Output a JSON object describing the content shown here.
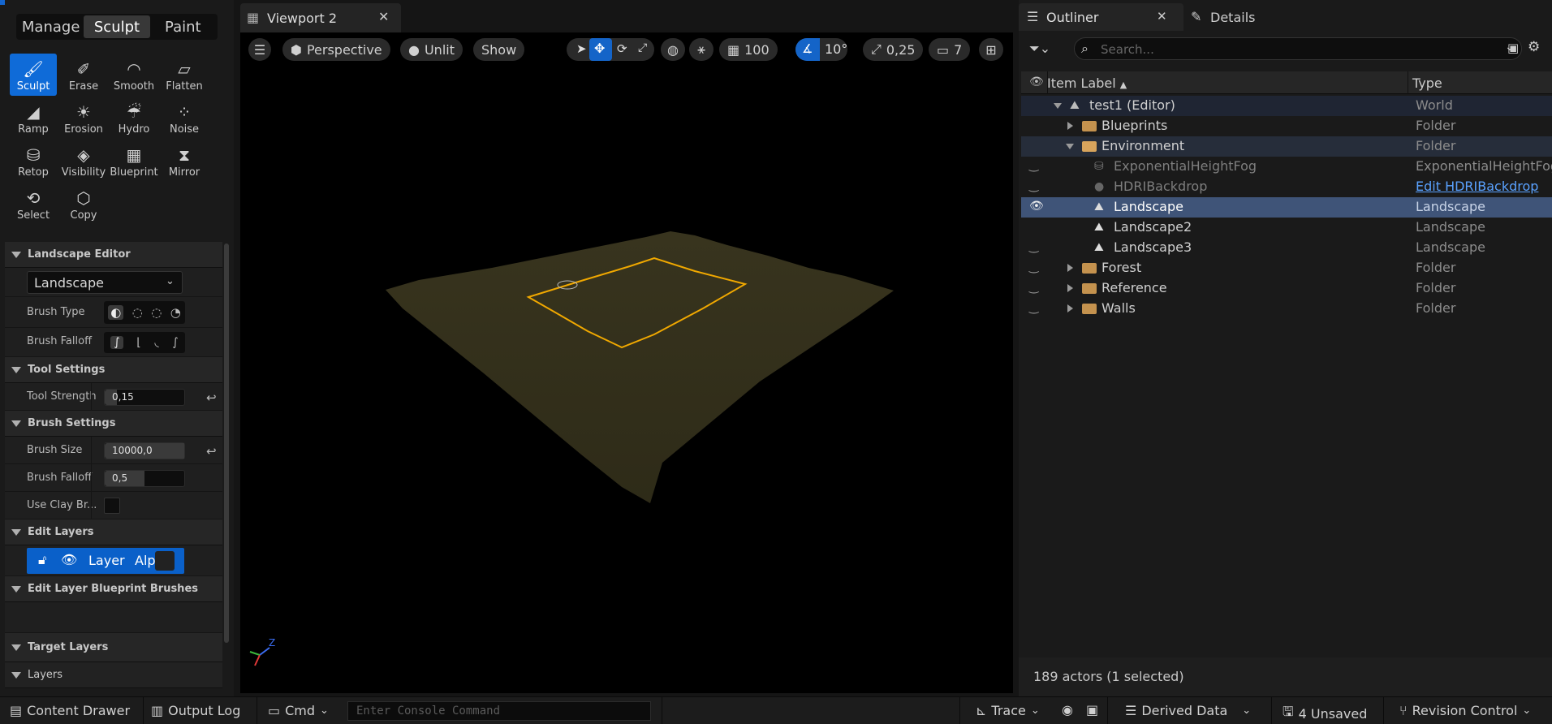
{
  "modes": [
    {
      "label": "Manage",
      "active": false
    },
    {
      "label": "Sculpt",
      "active": true
    },
    {
      "label": "Paint",
      "active": false
    }
  ],
  "tools": [
    {
      "label": "Sculpt",
      "icon": "brush-icon",
      "glyph": "🖌",
      "active": true
    },
    {
      "label": "Erase",
      "icon": "eraser-icon",
      "glyph": "✐",
      "active": false
    },
    {
      "label": "Smooth",
      "icon": "smooth-icon",
      "glyph": "◠",
      "active": false
    },
    {
      "label": "Flatten",
      "icon": "flatten-icon",
      "glyph": "⏥",
      "active": false
    },
    {
      "label": "Ramp",
      "icon": "ramp-icon",
      "glyph": "◢",
      "active": false
    },
    {
      "label": "Erosion",
      "icon": "erosion-icon",
      "glyph": "☀",
      "active": false
    },
    {
      "label": "Hydro",
      "icon": "hydro-icon",
      "glyph": "☔",
      "active": false
    },
    {
      "label": "Noise",
      "icon": "noise-icon",
      "glyph": "⁘",
      "active": false
    },
    {
      "label": "Retop",
      "icon": "retopologize-icon",
      "glyph": "⛁",
      "active": false
    },
    {
      "label": "Visibility",
      "icon": "visibility-icon",
      "glyph": "◈",
      "active": false
    },
    {
      "label": "Blueprint",
      "icon": "blueprint-icon",
      "glyph": "▦",
      "active": false
    },
    {
      "label": "Mirror",
      "icon": "mirror-icon",
      "glyph": "⧗",
      "active": false
    },
    {
      "label": "Select",
      "icon": "select-icon",
      "glyph": "⟲",
      "active": false
    },
    {
      "label": "Copy",
      "icon": "copy-icon",
      "glyph": "⬡",
      "active": false
    }
  ],
  "landscape_editor": {
    "title": "Landscape Editor",
    "selected_landscape": "Landscape",
    "brush_type_label": "Brush Type",
    "brush_falloff_label": "Brush Falloff"
  },
  "tool_settings": {
    "title": "Tool Settings",
    "tool_strength_label": "Tool Strength",
    "tool_strength_value": "0,15",
    "tool_strength_fraction": 0.15
  },
  "brush_settings": {
    "title": "Brush Settings",
    "brush_size_label": "Brush Size",
    "brush_size_value": "10000,0",
    "brush_size_fraction": 1.0,
    "brush_falloff_label": "Brush Falloff",
    "brush_falloff_value": "0,5",
    "brush_falloff_fraction": 0.5,
    "use_clay_label": "Use Clay Br..."
  },
  "edit_layers": {
    "title": "Edit Layers",
    "layer_name": "Layer",
    "alpha_label": "Alp"
  },
  "sections": {
    "blueprint_brushes": "Edit Layer Blueprint Brushes",
    "target_layers": "Target Layers",
    "layers": "Layers"
  },
  "viewport": {
    "tab_title": "Viewport 2",
    "perspective": "Perspective",
    "lit_mode": "Unlit",
    "show": "Show",
    "grid_snap": "100",
    "rotation_snap": "10°",
    "scale_snap": "0,25",
    "camera_speed": "7",
    "axis_z": "Z"
  },
  "outliner": {
    "tab_title": "Outliner",
    "details_tab": "Details",
    "search_placeholder": "Search...",
    "col_label": "Item Label",
    "col_type": "Type",
    "rows": [
      {
        "label": "test1 (Editor)",
        "type": "World",
        "indent": 0,
        "kind": "world",
        "expander": "open",
        "eye": false,
        "selected": false,
        "dim": false
      },
      {
        "label": "Blueprints",
        "type": "Folder",
        "indent": 1,
        "kind": "folder",
        "expander": "closed",
        "eye": false,
        "selected": false,
        "dim": false
      },
      {
        "label": "Environment",
        "type": "Folder",
        "indent": 1,
        "kind": "folder-open",
        "expander": "open",
        "eye": false,
        "selected": false,
        "dim": false,
        "highlight": true
      },
      {
        "label": "ExponentialHeightFog",
        "type": "ExponentialHeightFog",
        "indent": 2,
        "kind": "fog",
        "expander": "none",
        "eye": "closed",
        "selected": false,
        "dim": true
      },
      {
        "label": "HDRIBackdrop",
        "type": "Edit HDRIBackdrop",
        "indent": 2,
        "kind": "sphere",
        "expander": "none",
        "eye": "closed",
        "selected": false,
        "dim": true,
        "link": true
      },
      {
        "label": "Landscape",
        "type": "Landscape",
        "indent": 2,
        "kind": "landscape",
        "expander": "none",
        "eye": "open",
        "selected": true,
        "dim": false
      },
      {
        "label": "Landscape2",
        "type": "Landscape",
        "indent": 2,
        "kind": "landscape",
        "expander": "none",
        "eye": false,
        "selected": false,
        "dim": false
      },
      {
        "label": "Landscape3",
        "type": "Landscape",
        "indent": 2,
        "kind": "landscape",
        "expander": "none",
        "eye": "closed",
        "selected": false,
        "dim": false
      },
      {
        "label": "Forest",
        "type": "Folder",
        "indent": 1,
        "kind": "folder",
        "expander": "closed",
        "eye": "closed",
        "selected": false,
        "dim": false
      },
      {
        "label": "Reference",
        "type": "Folder",
        "indent": 1,
        "kind": "folder",
        "expander": "closed",
        "eye": "closed",
        "selected": false,
        "dim": false
      },
      {
        "label": "Walls",
        "type": "Folder",
        "indent": 1,
        "kind": "folder",
        "expander": "closed",
        "eye": "closed",
        "selected": false,
        "dim": false
      }
    ],
    "status": "189 actors (1 selected)"
  },
  "bottom_bar": {
    "content_drawer": "Content Drawer",
    "output_log": "Output Log",
    "cmd": "Cmd",
    "console_placeholder": "Enter Console Command",
    "trace": "Trace",
    "derived_data": "Derived Data",
    "unsaved": "4 Unsaved",
    "revision_control": "Revision Control"
  },
  "colors": {
    "accent": "#0f6bd8",
    "selection": "#0a58c4",
    "selection_outline": "#f0a800",
    "terrain": "#34311b"
  }
}
